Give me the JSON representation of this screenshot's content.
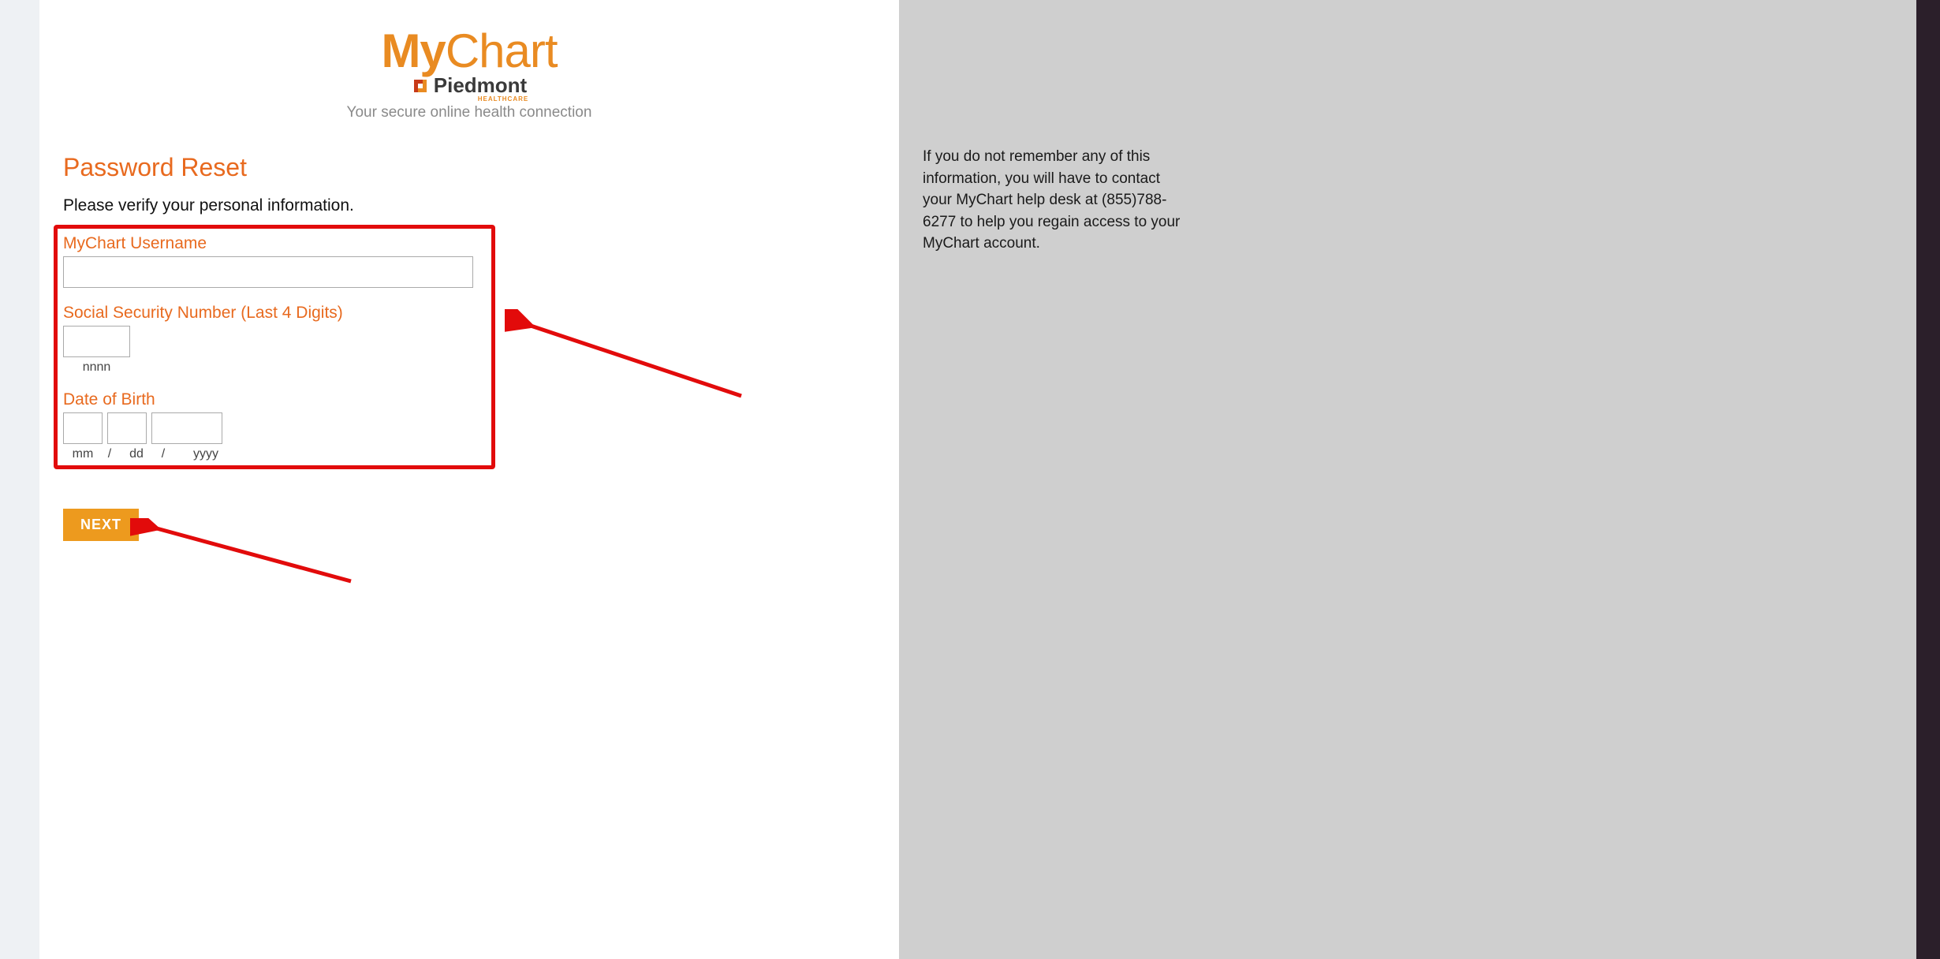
{
  "logo": {
    "my": "My",
    "chart": "Chart",
    "piedmont": "Piedmont",
    "healthcare": "HEALTHCARE",
    "tagline": "Your secure online health connection"
  },
  "page": {
    "title": "Password Reset",
    "instruction": "Please verify your personal information."
  },
  "form": {
    "username_label": "MyChart Username",
    "username_value": "",
    "ssn_label": "Social Security Number (Last 4 Digits)",
    "ssn_value": "",
    "ssn_hint": "nnnn",
    "dob_label": "Date of Birth",
    "dob_mm": "",
    "dob_dd": "",
    "dob_yyyy": "",
    "dob_hint_mm": "mm",
    "dob_hint_dd": "dd",
    "dob_hint_yyyy": "yyyy",
    "dob_sep": "/",
    "next_label": "NEXT"
  },
  "side": {
    "help_text": "If you do not remember any of this information, you will have to contact your MyChart help desk at (855)788-6277 to help you regain access to your MyChart account."
  }
}
